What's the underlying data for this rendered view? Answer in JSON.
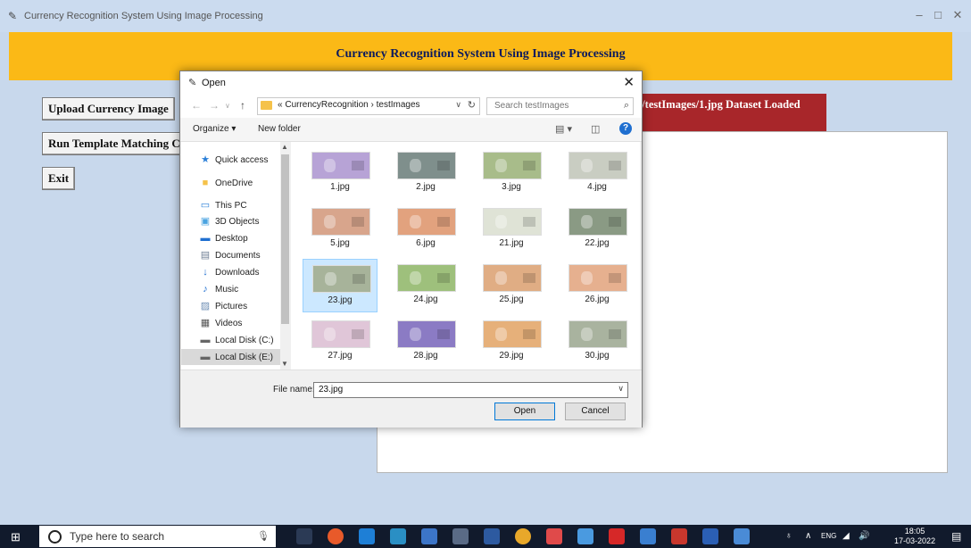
{
  "window": {
    "title": "Currency Recognition System Using Image Processing",
    "minimize_icon": "minimize-icon",
    "maximize_icon": "maximize-icon",
    "close_icon": "close-icon"
  },
  "app": {
    "header": "Currency Recognition System Using Image Processing",
    "buttons": {
      "upload": "Upload Currency Image",
      "run": "Run Template Matching Currency Recognition",
      "exit": "Exit"
    },
    "status": "on/testImages/1.jpg Dataset Loaded"
  },
  "dialog": {
    "title": "Open",
    "path": [
      "CurrencyRecognition",
      "testImages"
    ],
    "path_prefix": "«",
    "search_placeholder": "Search testImages",
    "toolbar": {
      "organize": "Organize ▾",
      "new_folder": "New folder"
    },
    "nav_items": [
      {
        "label": "Quick access",
        "icon": "star-icon"
      },
      {
        "label": "OneDrive",
        "icon": "folder-icon"
      },
      {
        "label": "This PC",
        "icon": "computer-icon"
      },
      {
        "label": "3D Objects",
        "icon": "cube-icon"
      },
      {
        "label": "Desktop",
        "icon": "desktop-icon"
      },
      {
        "label": "Documents",
        "icon": "document-icon"
      },
      {
        "label": "Downloads",
        "icon": "download-icon"
      },
      {
        "label": "Music",
        "icon": "music-icon"
      },
      {
        "label": "Pictures",
        "icon": "pictures-icon"
      },
      {
        "label": "Videos",
        "icon": "videos-icon"
      },
      {
        "label": "Local Disk (C:)",
        "icon": "disk-icon"
      },
      {
        "label": "Local Disk (E:)",
        "icon": "disk-icon",
        "selected": true
      }
    ],
    "files": [
      {
        "name": "1.jpg",
        "color": "#b7a3d6"
      },
      {
        "name": "2.jpg",
        "color": "#7f8f8c"
      },
      {
        "name": "3.jpg",
        "color": "#a8bc8a"
      },
      {
        "name": "4.jpg",
        "color": "#c9cdc2"
      },
      {
        "name": "5.jpg",
        "color": "#d8a58c"
      },
      {
        "name": "6.jpg",
        "color": "#e2a27e"
      },
      {
        "name": "21.jpg",
        "color": "#dfe3d6"
      },
      {
        "name": "22.jpg",
        "color": "#8a9a84"
      },
      {
        "name": "23.jpg",
        "color": "#a7b39a",
        "selected": true
      },
      {
        "name": "24.jpg",
        "color": "#9ec07c"
      },
      {
        "name": "25.jpg",
        "color": "#e0ad84"
      },
      {
        "name": "26.jpg",
        "color": "#e6b08f"
      },
      {
        "name": "27.jpg",
        "color": "#e0c6d8"
      },
      {
        "name": "28.jpg",
        "color": "#8b7bc4"
      },
      {
        "name": "29.jpg",
        "color": "#e6b07a"
      },
      {
        "name": "30.jpg",
        "color": "#a9b39f"
      }
    ],
    "file_name_label": "File name:",
    "file_name_value": "23.jpg",
    "open_label": "Open",
    "cancel_label": "Cancel"
  },
  "taskbar": {
    "search_placeholder": "Type here to search",
    "time": "18:05",
    "date": "17-03-2022",
    "tray_text": "ENG"
  }
}
